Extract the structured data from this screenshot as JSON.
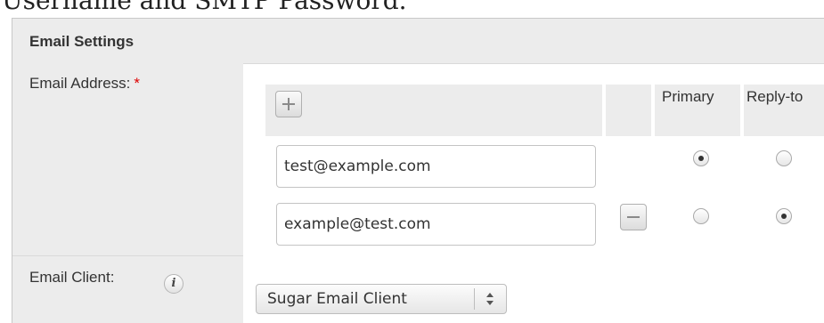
{
  "page": {
    "heading": "Username and SMTP Password."
  },
  "panel": {
    "title": "Email Settings"
  },
  "email_address": {
    "label": "Email Address:",
    "required_marker": "*",
    "columns": {
      "primary": "Primary",
      "reply_to": "Reply-to"
    },
    "add_icon": "plus-icon",
    "remove_icon": "minus-icon",
    "rows": [
      {
        "value": "test@example.com",
        "primary": true,
        "reply_to": false
      },
      {
        "value": "example@test.com",
        "primary": false,
        "reply_to": true
      }
    ]
  },
  "email_client": {
    "label": "Email Client:",
    "info_icon": "info-icon",
    "info_glyph": "i",
    "selected": "Sugar Email Client"
  }
}
